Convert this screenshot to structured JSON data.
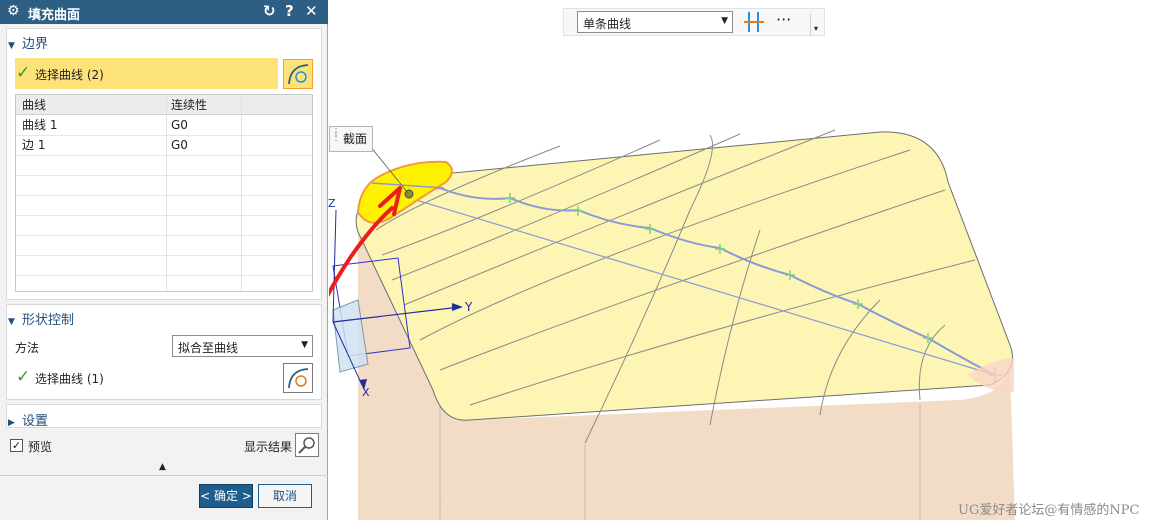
{
  "dialog": {
    "title": "填充曲面",
    "icons": {
      "settings": "gear-icon",
      "reset": "reset-icon",
      "help": "help-icon",
      "close": "close-icon"
    },
    "reset_glyph": "↻",
    "help_glyph": "?",
    "close_glyph": "✕",
    "boundary": {
      "header": "边界",
      "select_label": "选择曲线 (2)",
      "columns": [
        "曲线",
        "连续性"
      ],
      "rows": [
        {
          "curve": "曲线 1",
          "continuity": "G0"
        },
        {
          "curve": "边 1",
          "continuity": "G0"
        }
      ]
    },
    "shape_control": {
      "header": "形状控制",
      "method_label": "方法",
      "method_value": "拟合至曲线",
      "select_label": "选择曲线 (1)"
    },
    "settings_header": "设置",
    "preview_label": "预览",
    "preview_checked": true,
    "show_result_label": "显示结果",
    "ok_label": "< 确定 >",
    "cancel_label": "取消"
  },
  "toolbar": {
    "filter_value": "单条曲线",
    "more_glyph": "···"
  },
  "viewport": {
    "tooltip": "截面",
    "axis_z": "Z",
    "axis_y": "Y",
    "axis_x": "X",
    "watermark": "UG爱好者论坛@有情感的NPC"
  },
  "colors": {
    "titlebar": "#2d5f85",
    "selection_highlight": "#fde27a",
    "surface_top": "#fdf5b4",
    "surface_side": "#f2dcc5",
    "curve": "#8a9ad6",
    "annotation_red": "#ee1c1c",
    "check_green": "#2ea02e"
  }
}
